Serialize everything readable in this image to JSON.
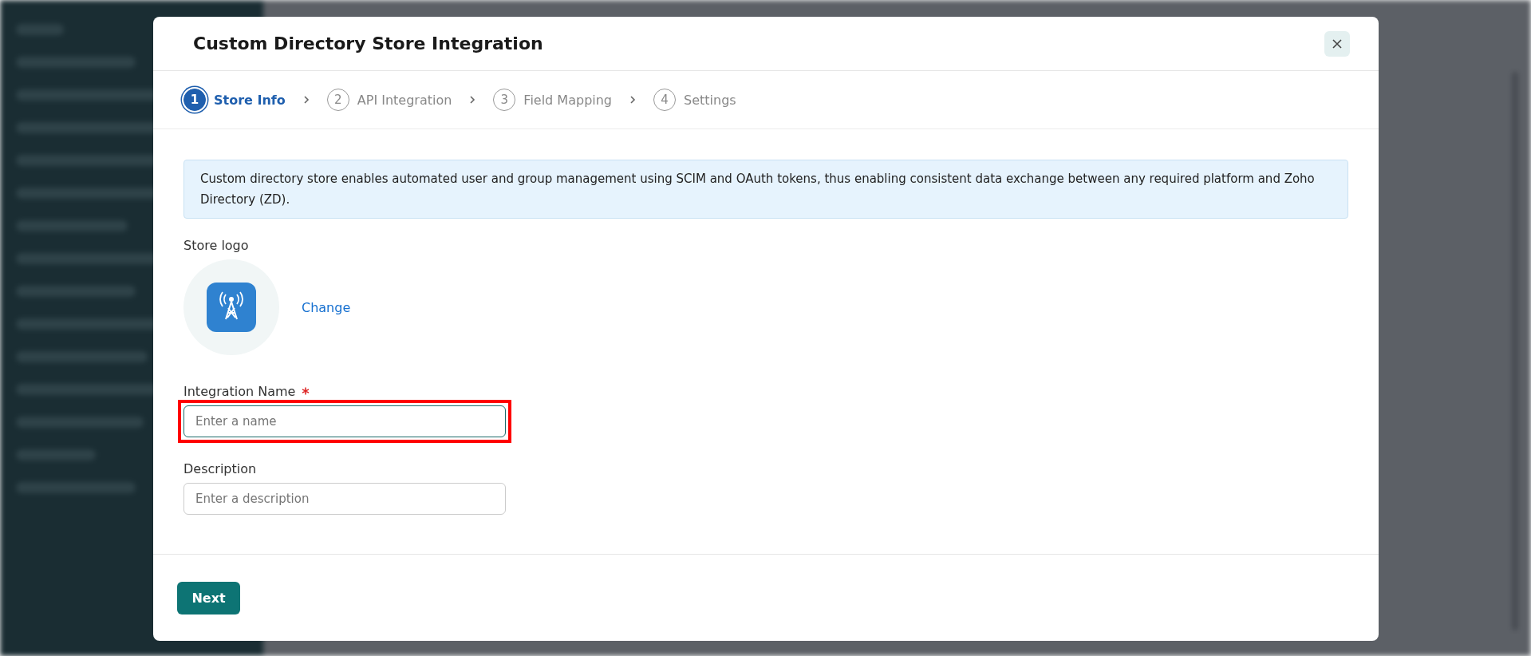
{
  "dialog": {
    "title": "Custom Directory Store Integration",
    "steps": [
      {
        "number": "1",
        "label": "Store Info",
        "selected": true
      },
      {
        "number": "2",
        "label": "API Integration",
        "selected": false
      },
      {
        "number": "3",
        "label": "Field Mapping",
        "selected": false
      },
      {
        "number": "4",
        "label": "Settings",
        "selected": false
      }
    ],
    "info": "Custom directory store enables automated user and group management using SCIM and OAuth tokens, thus enabling consistent data exchange between any required platform and Zoho Directory (ZD).",
    "logo": {
      "label": "Store logo",
      "action": "Change"
    },
    "fields": [
      {
        "label": "Integration Name",
        "required": true,
        "placeholder": "Enter a name",
        "highlighted": true
      },
      {
        "label": "Description",
        "required": false,
        "placeholder": "Enter a description",
        "highlighted": false
      }
    ],
    "next_button": "Next"
  }
}
